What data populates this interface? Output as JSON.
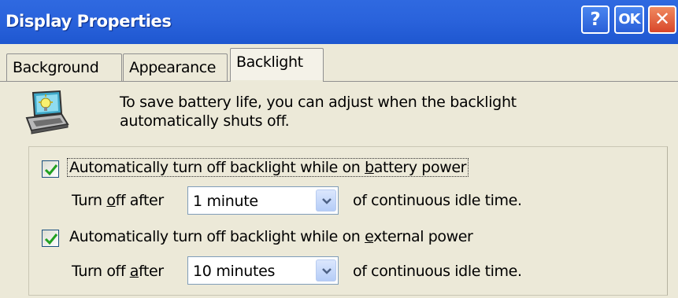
{
  "window": {
    "title": "Display Properties",
    "help_label": "?",
    "ok_label": "OK",
    "close_label": "✕"
  },
  "tabs": [
    {
      "label": "Background",
      "selected": false
    },
    {
      "label": "Appearance",
      "selected": false
    },
    {
      "label": "Backlight",
      "selected": true
    }
  ],
  "intro": {
    "icon": "laptop-backlight-icon",
    "line1": "To save battery life, you can adjust when the backlight",
    "line2": "automatically shuts off."
  },
  "battery": {
    "checked": true,
    "label_pre": "Automatically turn off backlight while on ",
    "label_accel": "b",
    "label_post": "attery power",
    "turn_off_pre": "Turn ",
    "turn_off_accel": "o",
    "turn_off_post": "ff after",
    "timeout_value": "1 minute",
    "suffix": "of continuous idle time."
  },
  "external": {
    "checked": true,
    "label_pre": "Automatically turn off backlight while on ",
    "label_accel": "e",
    "label_post": "xternal power",
    "turn_off_pre": "Turn off ",
    "turn_off_accel": "a",
    "turn_off_post": "fter",
    "timeout_value": "10 minutes",
    "suffix": "of continuous idle time."
  },
  "colors": {
    "titlebar": "#2a63dc",
    "dialog_bg": "#ece9d8",
    "check_green": "#21a121"
  }
}
